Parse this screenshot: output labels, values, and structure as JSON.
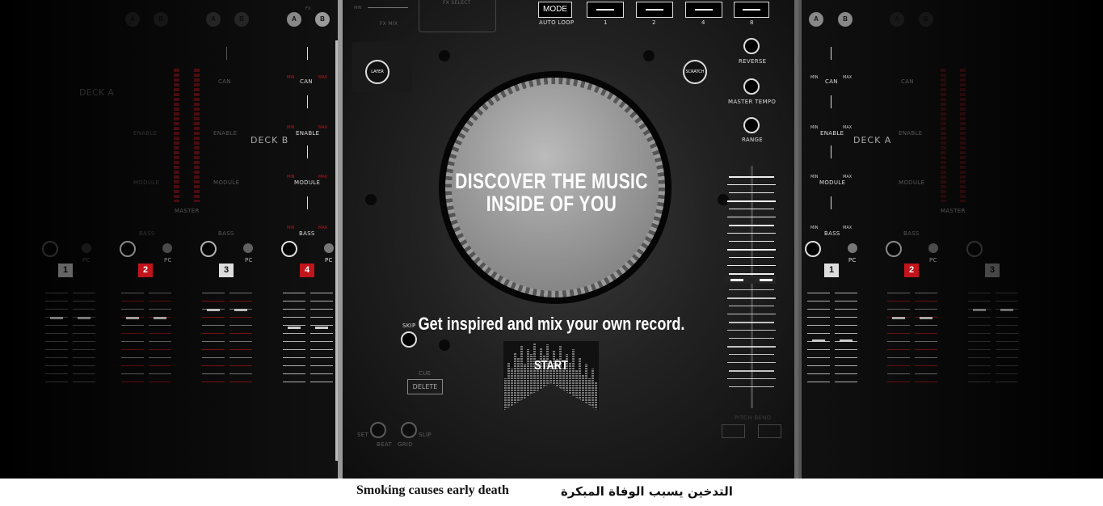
{
  "hero": {
    "title_line1": "DISCOVER THE MUSIC",
    "title_line2": "INSIDE OF YOU",
    "subtitle": "Get inspired and mix your own record.",
    "start_label": "START"
  },
  "top_controls": {
    "fx_label": "FX",
    "fx_select": "FX SELECT",
    "fx_mix": "FX MIX",
    "min": "MIN",
    "mode": "MODE",
    "auto_loop": "AUTO LOOP",
    "loop_values": [
      "1",
      "2",
      "4",
      "8"
    ]
  },
  "center_buttons": {
    "layer": "LAYER",
    "scratch": "SCRATCH",
    "reverse": "REVERSE",
    "master_tempo": "MASTER TEMPO",
    "range": "RANGE",
    "skip": "SKIP",
    "cue": "CUE",
    "delete": "DELETE",
    "set": "SET",
    "beat": "BEAT",
    "grid": "GRID",
    "slip": "SLIP",
    "pitch_bend": "PITCH BEND"
  },
  "left_mixer": {
    "deck_a": "DECK A",
    "deck_b": "DECK B",
    "master": "MASTER",
    "ab": [
      "A",
      "B"
    ],
    "knob_labels": {
      "can": "CAN",
      "enable": "ENABLE",
      "module": "MODULE",
      "bass": "BASS"
    },
    "min": "MIN",
    "max": "MAX",
    "pc": "PC",
    "channels": [
      "1",
      "2",
      "3",
      "4"
    ]
  },
  "right_mixer": {
    "deck_a": "DECK A",
    "master": "MASTER",
    "ab": [
      "A",
      "B"
    ],
    "knob_labels": {
      "can": "CAN",
      "enable": "ENABLE",
      "module": "MODULE",
      "bass": "BASS"
    },
    "min": "MIN",
    "max": "MAX",
    "pc": "PC",
    "channels": [
      "1",
      "2",
      "3"
    ]
  },
  "footer": {
    "english": "Smoking causes early death",
    "arabic": "التدخين يسبب الوفاة المبكرة"
  },
  "colors": {
    "accent_red": "#c1141b",
    "background": "#050505",
    "text": "#ffffff"
  }
}
